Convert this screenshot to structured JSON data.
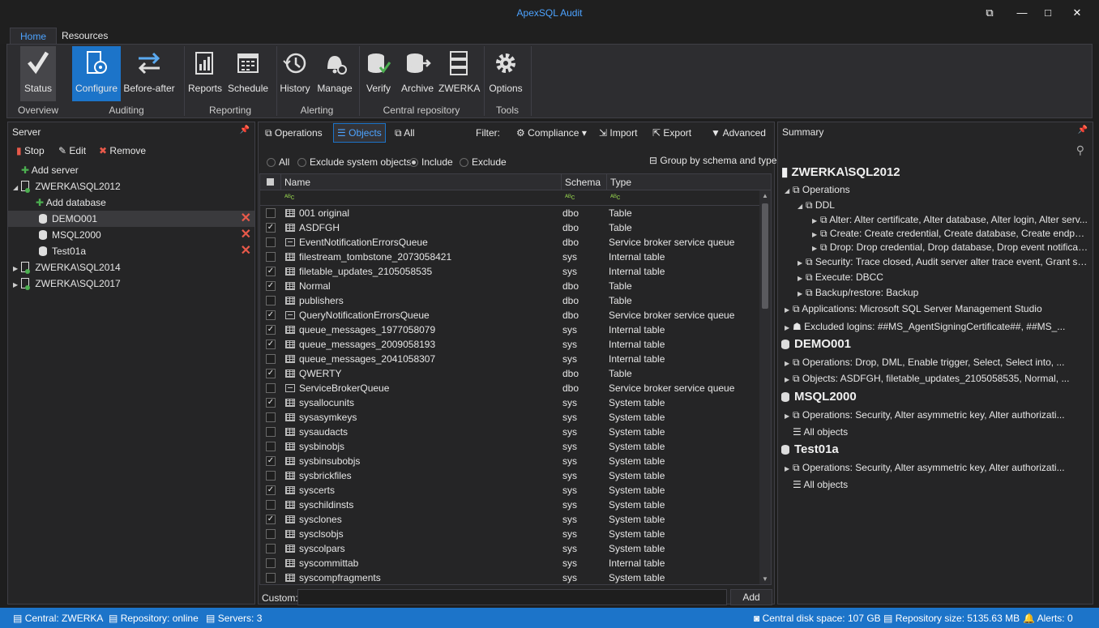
{
  "app": {
    "title": "ApexSQL Audit"
  },
  "tabs": [
    {
      "label": "Home"
    },
    {
      "label": "Resources"
    }
  ],
  "ribbon": {
    "buttons": [
      {
        "label": "Status"
      },
      {
        "label": "Configure"
      },
      {
        "label": "Before-after"
      },
      {
        "label": "Reports"
      },
      {
        "label": "Schedule"
      },
      {
        "label": "History"
      },
      {
        "label": "Manage"
      },
      {
        "label": "Verify"
      },
      {
        "label": "Archive"
      },
      {
        "label": "ZWERKA"
      },
      {
        "label": "Options"
      }
    ],
    "groups": [
      {
        "label": "Overview"
      },
      {
        "label": "Auditing"
      },
      {
        "label": "Reporting"
      },
      {
        "label": "Alerting"
      },
      {
        "label": "Central repository"
      },
      {
        "label": "Tools"
      }
    ]
  },
  "server_panel": {
    "title": "Server",
    "toolbar": {
      "stop": "Stop",
      "edit": "Edit",
      "remove": "Remove"
    },
    "tree": [
      {
        "label": "Add server"
      },
      {
        "label": "ZWERKA\\SQL2012"
      },
      {
        "label": "Add database"
      },
      {
        "label": "DEMO001"
      },
      {
        "label": "MSQL2000"
      },
      {
        "label": "Test01a"
      },
      {
        "label": "ZWERKA\\SQL2014"
      },
      {
        "label": "ZWERKA\\SQL2017"
      }
    ]
  },
  "objects_panel": {
    "toolbar": {
      "operations": "Operations",
      "objects": "Objects",
      "all": "All",
      "filter": "Filter:",
      "compliance": "Compliance",
      "import": "Import",
      "export": "Export",
      "advanced": "Advanced"
    },
    "radios": {
      "all": "All",
      "exclude_system": "Exclude system objects",
      "include": "Include",
      "exclude": "Exclude"
    },
    "group_by": "Group by schema and type",
    "columns": {
      "name": "Name",
      "schema": "Schema",
      "type": "Type"
    },
    "filter_glyph": "ᴬᴮc",
    "rows": [
      {
        "checked": false,
        "icon": "table",
        "name": "001 original",
        "schema": "dbo",
        "type": "Table"
      },
      {
        "checked": true,
        "icon": "table",
        "name": "ASDFGH",
        "schema": "dbo",
        "type": "Table"
      },
      {
        "checked": false,
        "icon": "queue",
        "name": "EventNotificationErrorsQueue",
        "schema": "dbo",
        "type": "Service broker service queue"
      },
      {
        "checked": false,
        "icon": "table",
        "name": "filestream_tombstone_2073058421",
        "schema": "sys",
        "type": "Internal table"
      },
      {
        "checked": true,
        "icon": "table",
        "name": "filetable_updates_2105058535",
        "schema": "sys",
        "type": "Internal table"
      },
      {
        "checked": true,
        "icon": "table",
        "name": "Normal",
        "schema": "dbo",
        "type": "Table"
      },
      {
        "checked": false,
        "icon": "table",
        "name": "publishers",
        "schema": "dbo",
        "type": "Table"
      },
      {
        "checked": true,
        "icon": "queue",
        "name": "QueryNotificationErrorsQueue",
        "schema": "dbo",
        "type": "Service broker service queue"
      },
      {
        "checked": true,
        "icon": "table",
        "name": "queue_messages_1977058079",
        "schema": "sys",
        "type": "Internal table"
      },
      {
        "checked": true,
        "icon": "table",
        "name": "queue_messages_2009058193",
        "schema": "sys",
        "type": "Internal table"
      },
      {
        "checked": false,
        "icon": "table",
        "name": "queue_messages_2041058307",
        "schema": "sys",
        "type": "Internal table"
      },
      {
        "checked": true,
        "icon": "table",
        "name": "QWERTY",
        "schema": "dbo",
        "type": "Table"
      },
      {
        "checked": false,
        "icon": "queue",
        "name": "ServiceBrokerQueue",
        "schema": "dbo",
        "type": "Service broker service queue"
      },
      {
        "checked": true,
        "icon": "table",
        "name": "sysallocunits",
        "schema": "sys",
        "type": "System table"
      },
      {
        "checked": false,
        "icon": "table",
        "name": "sysasymkeys",
        "schema": "sys",
        "type": "System table"
      },
      {
        "checked": false,
        "icon": "table",
        "name": "sysaudacts",
        "schema": "sys",
        "type": "System table"
      },
      {
        "checked": false,
        "icon": "table",
        "name": "sysbinobjs",
        "schema": "sys",
        "type": "System table"
      },
      {
        "checked": true,
        "icon": "table",
        "name": "sysbinsubobjs",
        "schema": "sys",
        "type": "System table"
      },
      {
        "checked": false,
        "icon": "table",
        "name": "sysbrickfiles",
        "schema": "sys",
        "type": "System table"
      },
      {
        "checked": true,
        "icon": "table",
        "name": "syscerts",
        "schema": "sys",
        "type": "System table"
      },
      {
        "checked": false,
        "icon": "table",
        "name": "syschildinsts",
        "schema": "sys",
        "type": "System table"
      },
      {
        "checked": true,
        "icon": "table",
        "name": "sysclones",
        "schema": "sys",
        "type": "System table"
      },
      {
        "checked": false,
        "icon": "table",
        "name": "sysclsobjs",
        "schema": "sys",
        "type": "System table"
      },
      {
        "checked": false,
        "icon": "table",
        "name": "syscolpars",
        "schema": "sys",
        "type": "System table"
      },
      {
        "checked": false,
        "icon": "table",
        "name": "syscommittab",
        "schema": "sys",
        "type": "Internal table"
      },
      {
        "checked": false,
        "icon": "table",
        "name": "syscompfragments",
        "schema": "sys",
        "type": "System table"
      }
    ],
    "custom_label": "Custom:",
    "custom_value": "",
    "add_button": "Add"
  },
  "summary_panel": {
    "title": "Summary",
    "lines": [
      "ZWERKA\\SQL2012",
      "Operations",
      "DDL",
      "Alter: Alter certificate, Alter database, Alter login, Alter serv...",
      "Create: Create credential, Create database, Create endpoint...",
      "Drop: Drop credential, Drop database, Drop event notificatio...",
      "Security: Trace closed, Audit server alter trace event, Grant serv...",
      "Execute: DBCC",
      "Backup/restore: Backup",
      "Applications: Microsoft SQL Server Management Studio",
      "Excluded logins: ##MS_AgentSigningCertificate##, ##MS_...",
      "DEMO001",
      "Operations: Drop, DML, Enable trigger, Select, Select into, ...",
      "Objects: ASDFGH, filetable_updates_2105058535, Normal, ...",
      "MSQL2000",
      "Operations: Security, Alter asymmetric key, Alter authorizati...",
      "All objects",
      "Test01a",
      "Operations: Security, Alter asymmetric key, Alter authorizati...",
      "All objects"
    ]
  },
  "statusbar": {
    "central": "Central: ZWERKA",
    "repository": "Repository: online",
    "servers": "Servers: 3",
    "disk": "Central disk space: 107 GB",
    "repo_size": "Repository size: 5135.63 MB",
    "alerts": "Alerts: 0"
  }
}
